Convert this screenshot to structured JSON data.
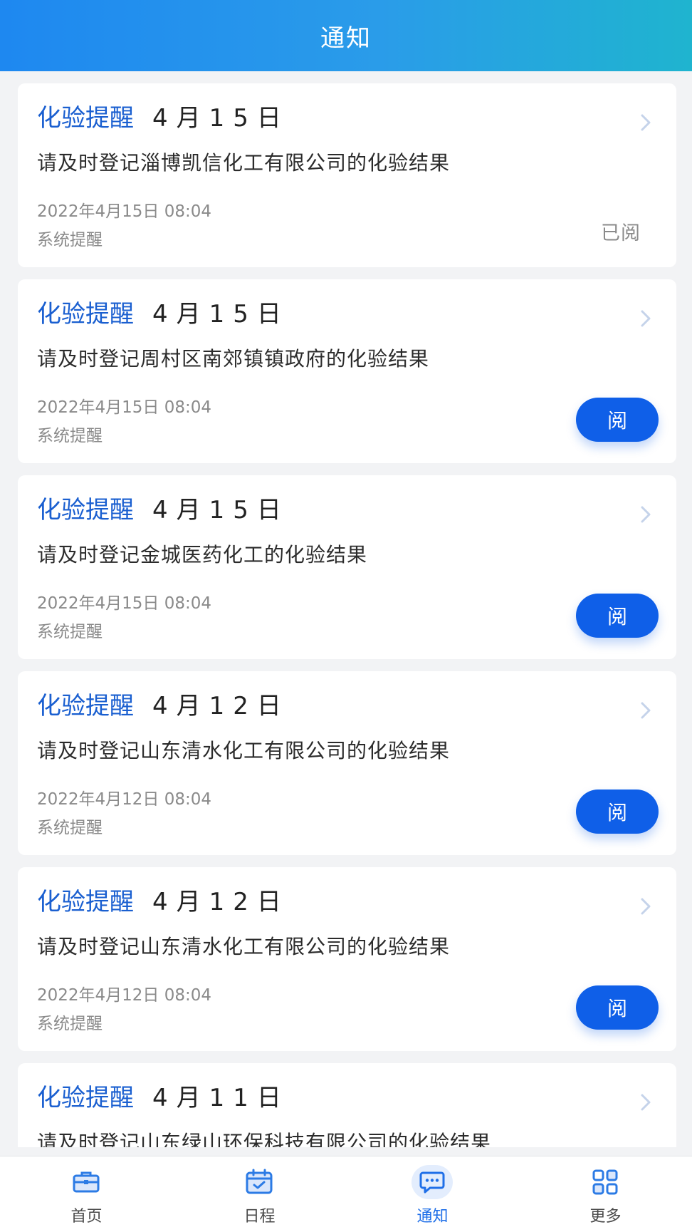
{
  "header": {
    "title": "通知"
  },
  "notifications": [
    {
      "type": "化验提醒",
      "date": "4月15日",
      "message": "请及时登记淄博凯信化工有限公司的化验结果",
      "time": "2022年4月15日 08:04",
      "source": "系统提醒",
      "read": true,
      "read_label": "已阅"
    },
    {
      "type": "化验提醒",
      "date": "4月15日",
      "message": "请及时登记周村区南郊镇镇政府的化验结果",
      "time": "2022年4月15日 08:04",
      "source": "系统提醒",
      "read": false,
      "action_label": "阅"
    },
    {
      "type": "化验提醒",
      "date": "4月15日",
      "message": "请及时登记金城医药化工的化验结果",
      "time": "2022年4月15日 08:04",
      "source": "系统提醒",
      "read": false,
      "action_label": "阅"
    },
    {
      "type": "化验提醒",
      "date": "4月12日",
      "message": "请及时登记山东清水化工有限公司的化验结果",
      "time": "2022年4月12日 08:04",
      "source": "系统提醒",
      "read": false,
      "action_label": "阅"
    },
    {
      "type": "化验提醒",
      "date": "4月12日",
      "message": "请及时登记山东清水化工有限公司的化验结果",
      "time": "2022年4月12日 08:04",
      "source": "系统提醒",
      "read": false,
      "action_label": "阅"
    },
    {
      "type": "化验提醒",
      "date": "4月11日",
      "message": "请及时登记山东绿山环保科技有限公司的化验结果"
    }
  ],
  "tabbar": {
    "active_index": 2,
    "items": [
      {
        "label": "首页",
        "icon": "briefcase-icon"
      },
      {
        "label": "日程",
        "icon": "calendar-check-icon"
      },
      {
        "label": "通知",
        "icon": "message-icon"
      },
      {
        "label": "更多",
        "icon": "grid-icon"
      }
    ]
  },
  "colors": {
    "accent": "#0f5fe8",
    "title_blue": "#1a5fd0",
    "header_start": "#1e88f0",
    "header_end": "#1fb4cf"
  }
}
